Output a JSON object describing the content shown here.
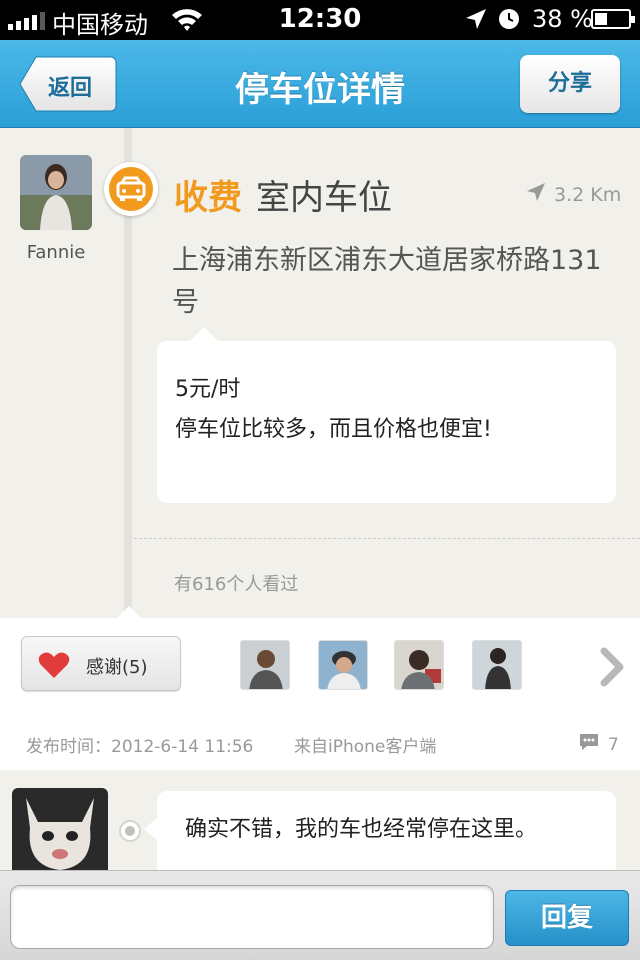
{
  "status_bar": {
    "carrier": "中国移动",
    "time": "12:30",
    "battery_percent": "38 %",
    "battery_level": 0.38
  },
  "nav": {
    "back_label": "返回",
    "title": "停车位详情",
    "share_label": "分享",
    "accent_color": "#2a9fd6"
  },
  "post": {
    "author_name": "Fannie",
    "fee_type": "收费",
    "spot_type": "室内车位",
    "distance": "3.2 Km",
    "address": "上海浦东新区浦东大道居家桥路131号",
    "price": "5元/时",
    "note": "停车位比较多，而且价格也便宜!",
    "views": "有616个人看过",
    "fee_color": "#f29a1d"
  },
  "actions": {
    "thanks_label": "感谢(5)",
    "thanked_users": [
      "user-1",
      "user-2",
      "user-3",
      "user-4"
    ]
  },
  "meta": {
    "publish_time": "发布时间：2012-6-14 11:56",
    "source": "来自iPhone客户端",
    "comment_count": "7"
  },
  "reply": {
    "text": "确实不错，我的车也经常停在这里。"
  },
  "input_bar": {
    "placeholder": "",
    "send_label": "回复"
  }
}
